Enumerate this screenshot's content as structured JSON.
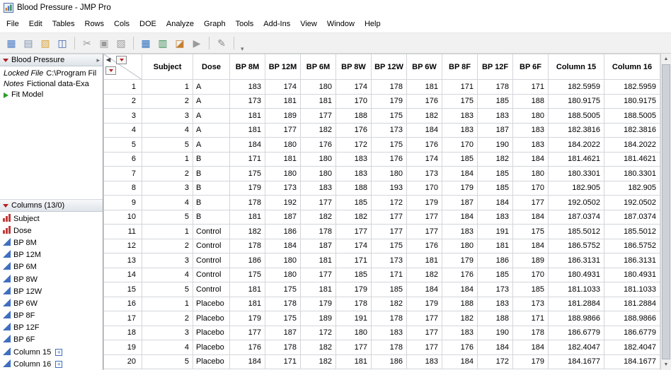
{
  "window": {
    "title": "Blood Pressure - JMP Pro"
  },
  "menu": {
    "items": [
      "File",
      "Edit",
      "Tables",
      "Rows",
      "Cols",
      "DOE",
      "Analyze",
      "Graph",
      "Tools",
      "Add-Ins",
      "View",
      "Window",
      "Help"
    ]
  },
  "toolbar": {
    "groups": [
      [
        "new-data-table",
        "new-journal",
        "open-file",
        "save-file"
      ],
      [
        "cut",
        "copy",
        "paste"
      ],
      [
        "data-table-view",
        "column-switcher",
        "graph-builder",
        "selection-tool"
      ],
      [
        "annotate"
      ]
    ]
  },
  "sidebar": {
    "table_panel": {
      "title": "Blood Pressure",
      "properties": [
        {
          "label": "Locked File",
          "value": "C:\\Program Fil"
        },
        {
          "label": "Notes",
          "value": "Fictional data-Exa"
        }
      ],
      "scripts": [
        {
          "label": "Fit Model"
        }
      ]
    },
    "columns_panel": {
      "title": "Columns (13/0)",
      "items": [
        {
          "label": "Subject",
          "type": "nominal"
        },
        {
          "label": "Dose",
          "type": "nominal"
        },
        {
          "label": "BP 8M",
          "type": "continuous"
        },
        {
          "label": "BP 12M",
          "type": "continuous"
        },
        {
          "label": "BP 6M",
          "type": "continuous"
        },
        {
          "label": "BP 8W",
          "type": "continuous"
        },
        {
          "label": "BP 12W",
          "type": "continuous"
        },
        {
          "label": "BP 6W",
          "type": "continuous"
        },
        {
          "label": "BP 8F",
          "type": "continuous"
        },
        {
          "label": "BP 12F",
          "type": "continuous"
        },
        {
          "label": "BP 6F",
          "type": "continuous"
        },
        {
          "label": "Column 15",
          "type": "continuous",
          "formula": true
        },
        {
          "label": "Column 16",
          "type": "continuous",
          "formula": true
        }
      ]
    }
  },
  "table": {
    "columns": [
      "Subject",
      "Dose",
      "BP 8M",
      "BP 12M",
      "BP 6M",
      "BP 8W",
      "BP 12W",
      "BP 6W",
      "BP 8F",
      "BP 12F",
      "BP 6F",
      "Column 15",
      "Column 16"
    ],
    "rows": [
      [
        "1",
        "A",
        "183",
        "174",
        "180",
        "174",
        "178",
        "181",
        "171",
        "178",
        "171",
        "182.5959",
        "182.5959"
      ],
      [
        "2",
        "A",
        "173",
        "181",
        "181",
        "170",
        "179",
        "176",
        "175",
        "185",
        "188",
        "180.9175",
        "180.9175"
      ],
      [
        "3",
        "A",
        "181",
        "189",
        "177",
        "188",
        "175",
        "182",
        "183",
        "183",
        "180",
        "188.5005",
        "188.5005"
      ],
      [
        "4",
        "A",
        "181",
        "177",
        "182",
        "176",
        "173",
        "184",
        "183",
        "187",
        "183",
        "182.3816",
        "182.3816"
      ],
      [
        "5",
        "A",
        "184",
        "180",
        "176",
        "172",
        "175",
        "176",
        "170",
        "190",
        "183",
        "184.2022",
        "184.2022"
      ],
      [
        "1",
        "B",
        "171",
        "181",
        "180",
        "183",
        "176",
        "174",
        "185",
        "182",
        "184",
        "181.4621",
        "181.4621"
      ],
      [
        "2",
        "B",
        "175",
        "180",
        "180",
        "183",
        "180",
        "173",
        "184",
        "185",
        "180",
        "180.3301",
        "180.3301"
      ],
      [
        "3",
        "B",
        "179",
        "173",
        "183",
        "188",
        "193",
        "170",
        "179",
        "185",
        "170",
        "182.905",
        "182.905"
      ],
      [
        "4",
        "B",
        "178",
        "192",
        "177",
        "185",
        "172",
        "179",
        "187",
        "184",
        "177",
        "192.0502",
        "192.0502"
      ],
      [
        "5",
        "B",
        "181",
        "187",
        "182",
        "182",
        "177",
        "177",
        "184",
        "183",
        "184",
        "187.0374",
        "187.0374"
      ],
      [
        "1",
        "Control",
        "182",
        "186",
        "178",
        "177",
        "177",
        "177",
        "183",
        "191",
        "175",
        "185.5012",
        "185.5012"
      ],
      [
        "2",
        "Control",
        "178",
        "184",
        "187",
        "174",
        "175",
        "176",
        "180",
        "181",
        "184",
        "186.5752",
        "186.5752"
      ],
      [
        "3",
        "Control",
        "186",
        "180",
        "181",
        "171",
        "173",
        "181",
        "179",
        "186",
        "189",
        "186.3131",
        "186.3131"
      ],
      [
        "4",
        "Control",
        "175",
        "180",
        "177",
        "185",
        "171",
        "182",
        "176",
        "185",
        "170",
        "180.4931",
        "180.4931"
      ],
      [
        "5",
        "Control",
        "181",
        "175",
        "181",
        "179",
        "185",
        "184",
        "184",
        "173",
        "185",
        "181.1033",
        "181.1033"
      ],
      [
        "1",
        "Placebo",
        "181",
        "178",
        "179",
        "178",
        "182",
        "179",
        "188",
        "183",
        "173",
        "181.2884",
        "181.2884"
      ],
      [
        "2",
        "Placebo",
        "179",
        "175",
        "189",
        "191",
        "178",
        "177",
        "182",
        "188",
        "171",
        "188.9866",
        "188.9866"
      ],
      [
        "3",
        "Placebo",
        "177",
        "187",
        "172",
        "180",
        "183",
        "177",
        "183",
        "190",
        "178",
        "186.6779",
        "186.6779"
      ],
      [
        "4",
        "Placebo",
        "176",
        "178",
        "182",
        "177",
        "178",
        "177",
        "176",
        "184",
        "184",
        "182.4047",
        "182.4047"
      ],
      [
        "5",
        "Placebo",
        "184",
        "171",
        "182",
        "181",
        "186",
        "183",
        "184",
        "172",
        "179",
        "184.1677",
        "184.1677"
      ]
    ]
  }
}
